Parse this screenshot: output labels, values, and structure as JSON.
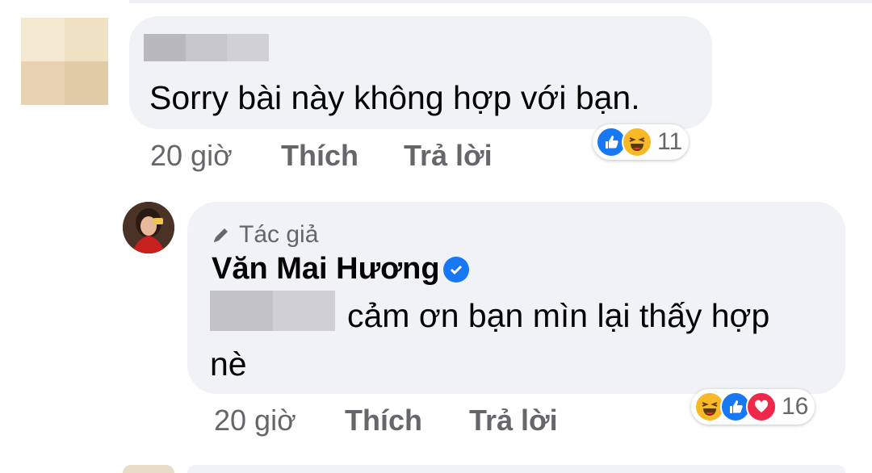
{
  "comment1": {
    "text": "Sorry bài này không hợp với bạn.",
    "time": "20 giờ",
    "like_label": "Thích",
    "reply_label": "Trả lời",
    "reaction_icons": [
      "like-icon",
      "haha-icon"
    ],
    "reaction_count": "11"
  },
  "reply": {
    "author_badge": "Tác giả",
    "author_name": "Văn Mai Hương",
    "text_line1": "cảm ơn bạn mìn lại thấy hợp",
    "text_line2": "nè",
    "time": "20 giờ",
    "like_label": "Thích",
    "reply_label": "Trả lời",
    "reaction_icons": [
      "haha-icon",
      "like-icon",
      "love-icon"
    ],
    "reaction_count": "16"
  },
  "colors": {
    "bubble_bg": "#f0f2f5",
    "meta_text": "#65676b",
    "like_blue": "#1877f2",
    "haha_yellow": "#f7b928",
    "love_red": "#f02849"
  }
}
